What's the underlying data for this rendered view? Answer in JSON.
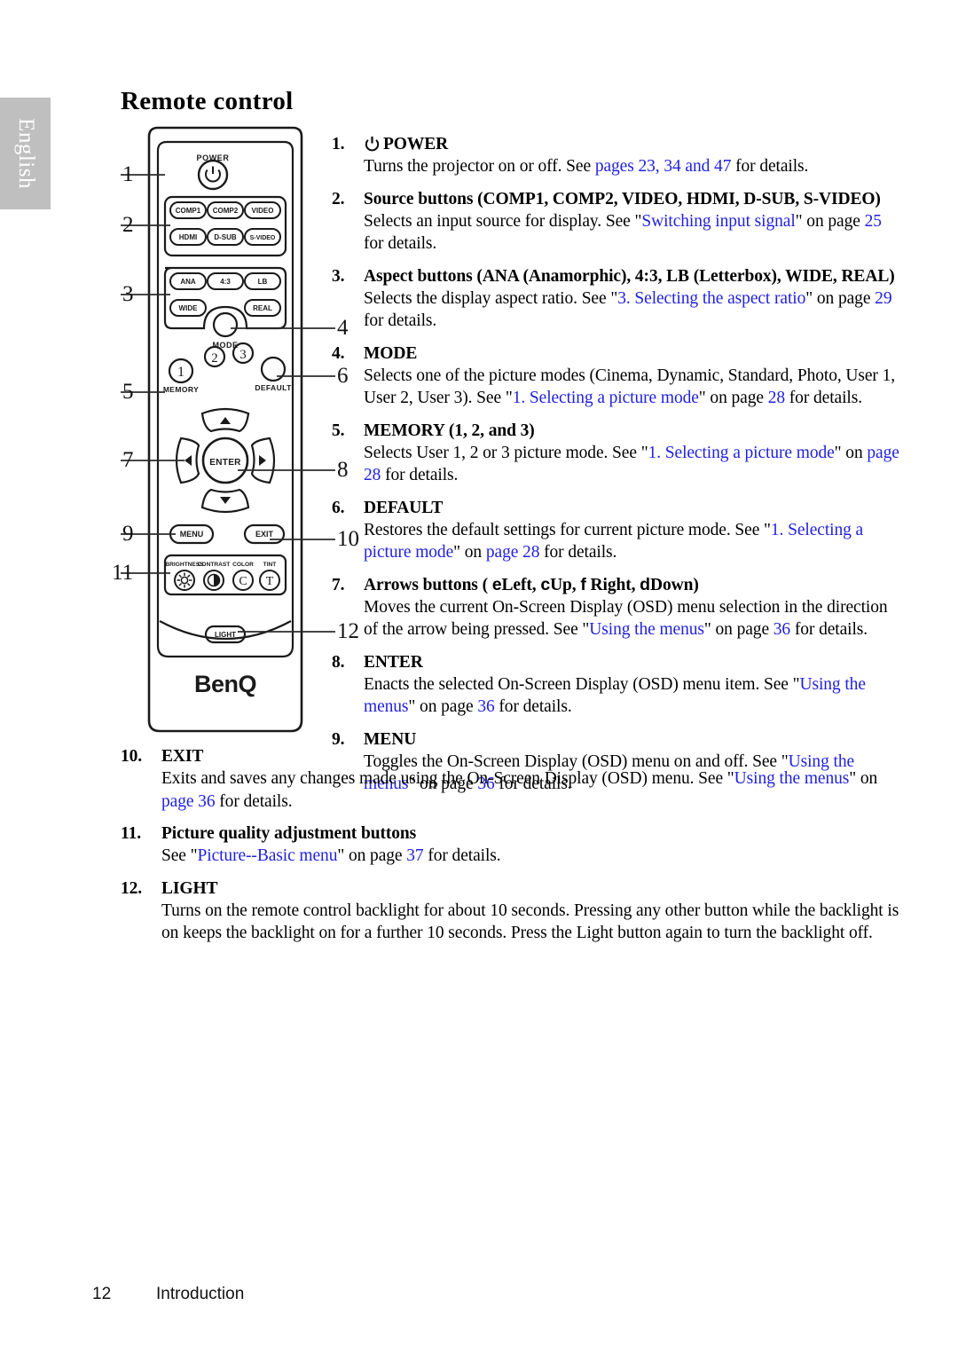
{
  "language_tab": {
    "label": "English"
  },
  "page_title": "Remote control",
  "link_color": "#2222dd",
  "remote": {
    "brand_logo": "BenQ",
    "buttons": {
      "power_label": "POWER",
      "sources": [
        "COMP1",
        "COMP2",
        "VIDEO",
        "HDMI",
        "D-SUB",
        "S-VIDEO"
      ],
      "aspects": [
        "ANA",
        "4:3",
        "LB",
        "WIDE",
        "REAL"
      ],
      "mode_label": "MODE",
      "memory_label": "MEMORY",
      "memory_numbers": [
        "1",
        "2",
        "3"
      ],
      "default_label": "DEFAULT",
      "enter_label": "ENTER",
      "menu_label": "MENU",
      "exit_label": "EXIT",
      "light_label": "LIGHT",
      "quality": [
        {
          "label": "BRIGHTNESS",
          "icon": "sun-icon"
        },
        {
          "label": "CONTRAST",
          "icon": "half-circle-icon"
        },
        {
          "label": "COLOR",
          "icon": "letter-c-icon"
        },
        {
          "label": "TINT",
          "icon": "letter-t-icon"
        }
      ]
    },
    "callouts_left": [
      "1",
      "2",
      "3",
      "5",
      "7",
      "9",
      "11"
    ],
    "callouts_right": [
      "4",
      "6",
      "8",
      "10",
      "12"
    ]
  },
  "items": [
    {
      "num": "1.",
      "has_power_icon": true,
      "heading": "POWER",
      "body": [
        {
          "t": "Turns the projector on or off. See ",
          "link": false
        },
        {
          "t": "pages 23, 34 and 47",
          "link": true
        },
        {
          "t": " for details.",
          "link": false
        }
      ]
    },
    {
      "num": "2.",
      "heading": "Source buttons (COMP1, COMP2, VIDEO, HDMI, D-SUB, S-VIDEO)",
      "body": [
        {
          "t": "Selects an input source for display. See \"",
          "link": false
        },
        {
          "t": "Switching input signal",
          "link": true
        },
        {
          "t": "\" on page ",
          "link": false
        },
        {
          "t": "25",
          "link": true
        },
        {
          "t": " for details.",
          "link": false
        }
      ]
    },
    {
      "num": "3.",
      "heading": "Aspect buttons (ANA (Anamorphic), 4:3, LB (Letterbox), WIDE, REAL)",
      "body": [
        {
          "t": "Selects the display aspect ratio. See \"",
          "link": false
        },
        {
          "t": "3. Selecting the aspect ratio",
          "link": true
        },
        {
          "t": "\" on page ",
          "link": false
        },
        {
          "t": "29",
          "link": true
        },
        {
          "t": " for details.",
          "link": false
        }
      ]
    },
    {
      "num": "4.",
      "heading": "MODE",
      "body": [
        {
          "t": "Selects one of the picture modes (Cinema, Dynamic, Standard, Photo, User 1, User 2, User 3). See \"",
          "link": false
        },
        {
          "t": "1. Selecting a picture mode",
          "link": true
        },
        {
          "t": "\" on page ",
          "link": false
        },
        {
          "t": "28",
          "link": true
        },
        {
          "t": " for details.",
          "link": false
        }
      ]
    },
    {
      "num": "5.",
      "heading": "MEMORY (1, 2, and 3)",
      "body": [
        {
          "t": "Selects User 1, 2 or 3 picture mode. See \"",
          "link": false
        },
        {
          "t": "1. Selecting a picture mode",
          "link": true
        },
        {
          "t": "\" on ",
          "link": false
        },
        {
          "t": "page 28",
          "link": true
        },
        {
          "t": " for details.",
          "link": false
        }
      ]
    },
    {
      "num": "6.",
      "heading": "DEFAULT",
      "body": [
        {
          "t": "Restores the default settings for current picture mode. See \"",
          "link": false
        },
        {
          "t": "1. Selecting a picture mode",
          "link": true
        },
        {
          "t": "\" on ",
          "link": false
        },
        {
          "t": "page 28",
          "link": true
        },
        {
          "t": " for details.",
          "link": false
        }
      ]
    },
    {
      "num": "7.",
      "heading_parts": [
        {
          "t": "Arrows buttons ( ",
          "glyph": false
        },
        {
          "t": "e",
          "glyph": true
        },
        {
          "t": "Left, ",
          "glyph": false
        },
        {
          "t": "c",
          "glyph": true
        },
        {
          "t": "Up, ",
          "glyph": false
        },
        {
          "t": "f",
          "glyph": true
        },
        {
          "t": " Right, ",
          "glyph": false
        },
        {
          "t": "d",
          "glyph": true
        },
        {
          "t": "Down)",
          "glyph": false
        }
      ],
      "body": [
        {
          "t": "Moves the current On-Screen Display (OSD) menu selection in the direction of the arrow being pressed. See \"",
          "link": false
        },
        {
          "t": "Using the menus",
          "link": true
        },
        {
          "t": "\" on page ",
          "link": false
        },
        {
          "t": "36",
          "link": true
        },
        {
          "t": " for details.",
          "link": false
        }
      ]
    },
    {
      "num": "8.",
      "heading": "ENTER",
      "body": [
        {
          "t": "Enacts the selected On-Screen Display (OSD) menu item. See \"",
          "link": false
        },
        {
          "t": "Using the menus",
          "link": true
        },
        {
          "t": "\" on page ",
          "link": false
        },
        {
          "t": "36",
          "link": true
        },
        {
          "t": " for details.",
          "link": false
        }
      ]
    },
    {
      "num": "9.",
      "heading": "MENU",
      "body": [
        {
          "t": "Toggles the On-Screen Display (OSD) menu on and off. See \"",
          "link": false
        },
        {
          "t": "Using the menus",
          "link": true
        },
        {
          "t": "\" on page ",
          "link": false
        },
        {
          "t": "36",
          "link": true
        },
        {
          "t": " for details.",
          "link": false
        }
      ]
    }
  ],
  "items_tail": [
    {
      "num": "10.",
      "heading": "EXIT",
      "body": [
        {
          "t": "Exits and saves any changes made using the On-Screen Display (OSD) menu. See \"",
          "link": false
        },
        {
          "t": "Using the menus",
          "link": true
        },
        {
          "t": "\" on ",
          "link": false
        },
        {
          "t": "page 36",
          "link": true
        },
        {
          "t": " for details.",
          "link": false
        }
      ]
    },
    {
      "num": "11.",
      "heading": "Picture quality adjustment buttons",
      "body": [
        {
          "t": "See \"",
          "link": false
        },
        {
          "t": "Picture--Basic menu",
          "link": true
        },
        {
          "t": "\" on page ",
          "link": false
        },
        {
          "t": "37",
          "link": true
        },
        {
          "t": " for details.",
          "link": false
        }
      ]
    },
    {
      "num": "12.",
      "heading": "LIGHT",
      "body": [
        {
          "t": "Turns on the remote control backlight for about 10 seconds. Pressing any other button while the backlight is on keeps the backlight on for a further 10 seconds. Press the Light button again to turn the backlight off.",
          "link": false
        }
      ]
    }
  ],
  "footer": {
    "page_number": "12",
    "section": "Introduction"
  }
}
